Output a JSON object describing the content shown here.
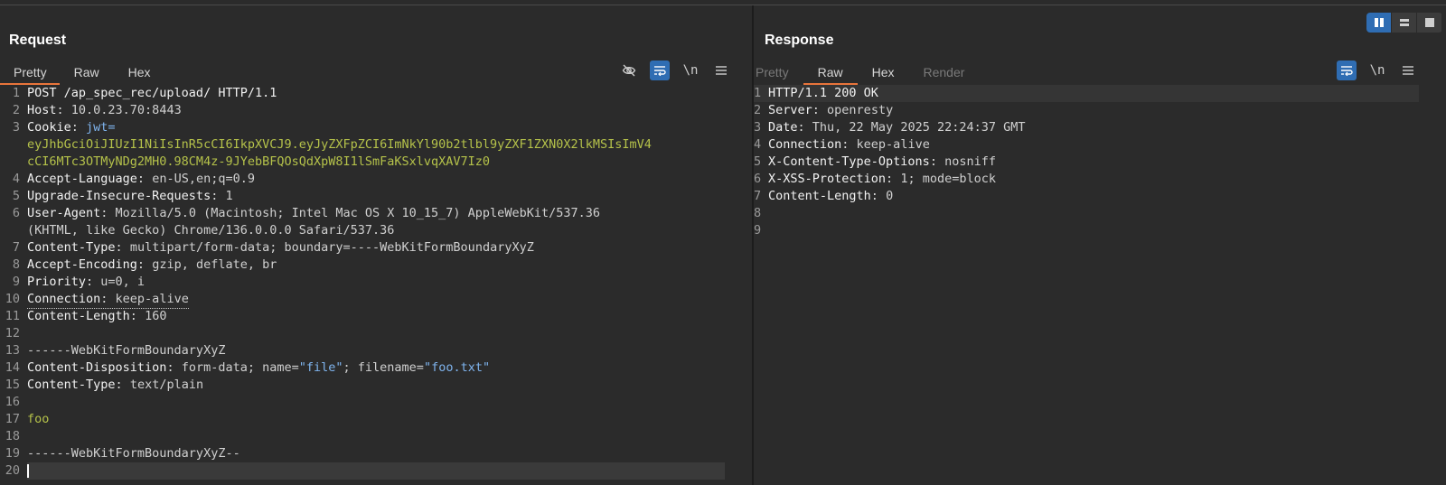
{
  "layout_toggle": {
    "options": [
      "split-vertical",
      "split-horizontal",
      "single"
    ],
    "active": "split-vertical"
  },
  "request": {
    "title": "Request",
    "tabs": [
      {
        "label": "Pretty",
        "active": true,
        "disabled": false
      },
      {
        "label": "Raw",
        "active": false,
        "disabled": false
      },
      {
        "label": "Hex",
        "active": false,
        "disabled": false
      }
    ],
    "tools": {
      "hide_icon": "eye-off-icon",
      "wrap_icon": "wrap-icon",
      "newline_label": "\\n",
      "menu_icon": "menu-icon"
    },
    "lines": [
      {
        "n": "1",
        "key": "POST /ap_spec_rec/upload/ HTTP/1.1",
        "sep": "",
        "val": ""
      },
      {
        "n": "2",
        "key": "Host",
        "sep": ": ",
        "val": "10.0.23.70:8443"
      },
      {
        "n": "3",
        "key": "Cookie",
        "sep": ": ",
        "val": "jwt="
      },
      {
        "n": "",
        "key": "",
        "sep": "",
        "val": "eyJhbGciOiJIUzI1NiIsInR5cCI6IkpXVCJ9.eyJyZXFpZCI6ImNkYl90b2tlbl9yZXF1ZXN0X2lkMSIsImV4"
      },
      {
        "n": "",
        "key": "",
        "sep": "",
        "val": "cCI6MTc3OTMyNDg2MH0.98CM4z-9JYebBFQOsQdXpW8I1lSmFaKSxlvqXAV7Iz0"
      },
      {
        "n": "4",
        "key": "Accept-Language",
        "sep": ": ",
        "val": "en-US,en;q=0.9"
      },
      {
        "n": "5",
        "key": "Upgrade-Insecure-Requests",
        "sep": ": ",
        "val": "1"
      },
      {
        "n": "6",
        "key": "User-Agent",
        "sep": ": ",
        "val": "Mozilla/5.0 (Macintosh; Intel Mac OS X 10_15_7) AppleWebKit/537.36"
      },
      {
        "n": "",
        "key": "",
        "sep": "",
        "val": "(KHTML, like Gecko) Chrome/136.0.0.0 Safari/537.36"
      },
      {
        "n": "7",
        "key": "Content-Type",
        "sep": ": ",
        "val": "multipart/form-data; boundary=----WebKitFormBoundaryXyZ"
      },
      {
        "n": "8",
        "key": "Accept-Encoding",
        "sep": ": ",
        "val": "gzip, deflate, br"
      },
      {
        "n": "9",
        "key": "Priority",
        "sep": ": ",
        "val": "u=0, i"
      },
      {
        "n": "10",
        "key": "Connection",
        "sep": ": ",
        "val": "keep-alive"
      },
      {
        "n": "11",
        "key": "Content-Length",
        "sep": ": ",
        "val": "160"
      },
      {
        "n": "12",
        "key": "",
        "sep": "",
        "val": ""
      },
      {
        "n": "13",
        "key": "------WebKitFormBoundaryXyZ",
        "sep": "",
        "val": ""
      },
      {
        "n": "14",
        "key": "Content-Disposition",
        "sep": ": ",
        "val": "form-data; name=",
        "str1": "\"file\"",
        "mid": "; filename=",
        "str2": "\"foo.txt\""
      },
      {
        "n": "15",
        "key": "Content-Type",
        "sep": ": ",
        "val": "text/plain"
      },
      {
        "n": "16",
        "key": "",
        "sep": "",
        "val": ""
      },
      {
        "n": "17",
        "key": "",
        "sep": "",
        "val": "foo"
      },
      {
        "n": "18",
        "key": "",
        "sep": "",
        "val": ""
      },
      {
        "n": "19",
        "key": "------WebKitFormBoundaryXyZ--",
        "sep": "",
        "val": ""
      },
      {
        "n": "20",
        "key": "",
        "sep": "",
        "val": ""
      }
    ]
  },
  "response": {
    "title": "Response",
    "tabs": [
      {
        "label": "Pretty",
        "active": false,
        "disabled": true
      },
      {
        "label": "Raw",
        "active": true,
        "disabled": false
      },
      {
        "label": "Hex",
        "active": false,
        "disabled": false
      },
      {
        "label": "Render",
        "active": false,
        "disabled": true
      }
    ],
    "tools": {
      "wrap_icon": "wrap-icon",
      "newline_label": "\\n",
      "menu_icon": "menu-icon"
    },
    "lines": [
      {
        "n": "1",
        "key": "HTTP/1.1 200 OK",
        "sep": "",
        "val": ""
      },
      {
        "n": "2",
        "key": "Server",
        "sep": ": ",
        "val": "openresty"
      },
      {
        "n": "3",
        "key": "Date",
        "sep": ": ",
        "val": "Thu, 22 May 2025 22:24:37 GMT"
      },
      {
        "n": "4",
        "key": "Connection",
        "sep": ": ",
        "val": "keep-alive"
      },
      {
        "n": "5",
        "key": "X-Content-Type-Options",
        "sep": ": ",
        "val": "nosniff"
      },
      {
        "n": "6",
        "key": "X-XSS-Protection",
        "sep": ": ",
        "val": "1; mode=block"
      },
      {
        "n": "7",
        "key": "Content-Length",
        "sep": ": ",
        "val": "0"
      },
      {
        "n": "8",
        "key": "",
        "sep": "",
        "val": ""
      },
      {
        "n": "9",
        "key": "",
        "sep": "",
        "val": ""
      }
    ]
  }
}
